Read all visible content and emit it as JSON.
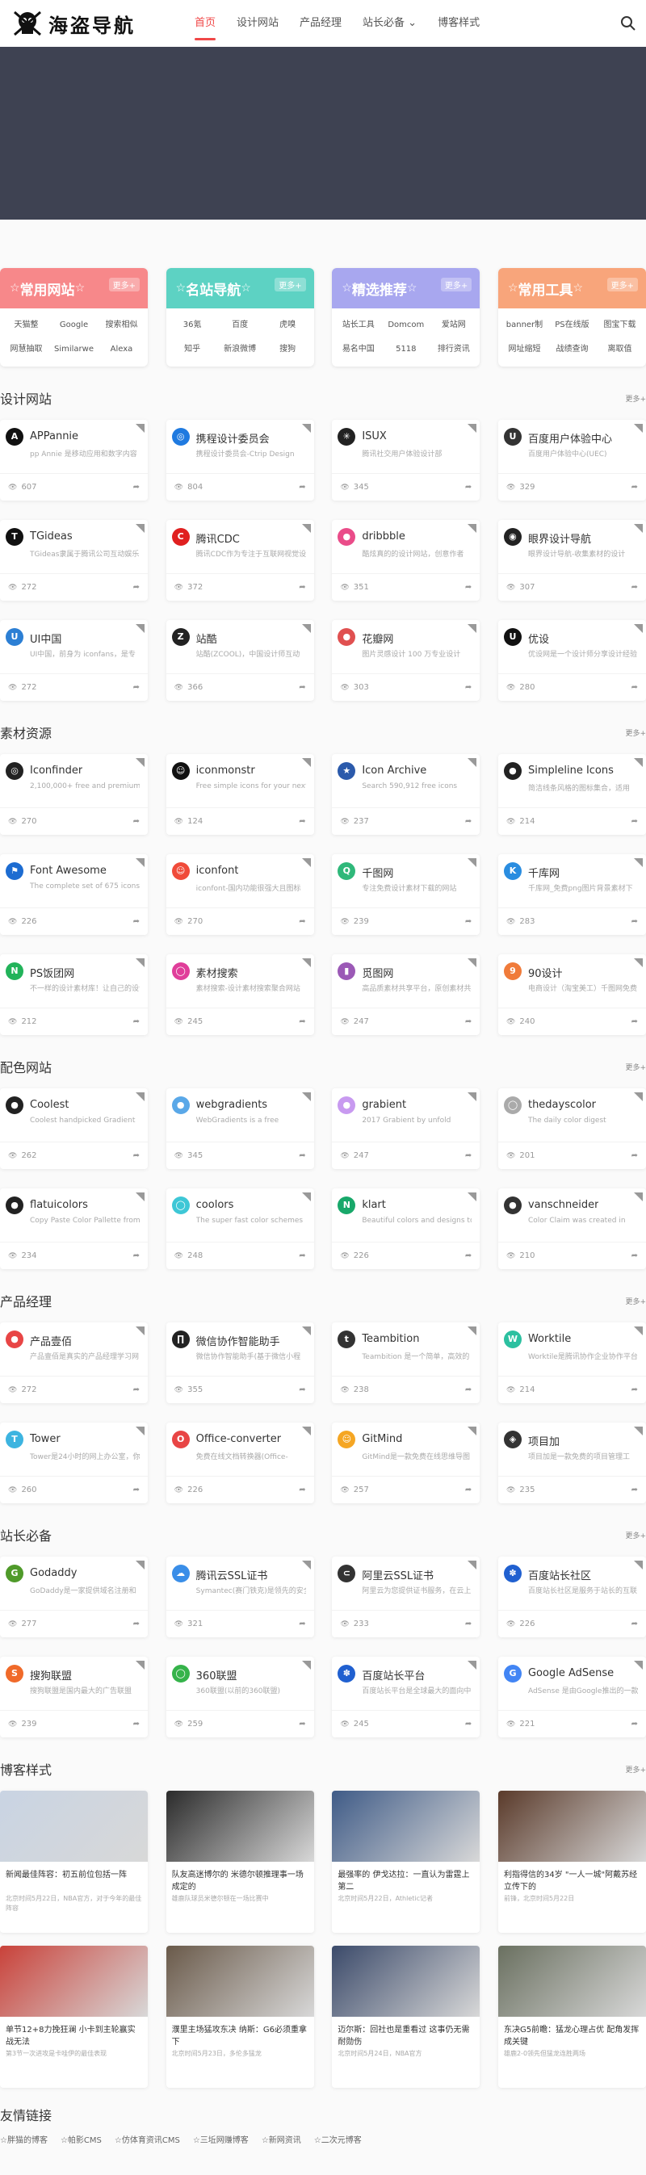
{
  "logo": {
    "text": "海盗导航"
  },
  "nav": [
    {
      "label": "首页",
      "active": true
    },
    {
      "label": "设计网站"
    },
    {
      "label": "产品经理"
    },
    {
      "label": "站长必备 ⌄"
    },
    {
      "label": "博客样式"
    }
  ],
  "colors": {
    "accent": "#f04848",
    "banner": "#3e4252",
    "cat1": "#f7888a",
    "cat2": "#5dd2c3",
    "cat3": "#a8a7ef",
    "cat4": "#f8a57b"
  },
  "categories": [
    {
      "title": "常用网站",
      "more": "更多+",
      "items": [
        "天猫整",
        "Google",
        "搜索相似",
        "网慧抽取",
        "Similarwe",
        "Alexa"
      ]
    },
    {
      "title": "名站导航",
      "more": "更多+",
      "items": [
        "36氪",
        "百度",
        "虎嗅",
        "知乎",
        "新浪微博",
        "搜狗"
      ]
    },
    {
      "title": "精选推荐",
      "more": "更多+",
      "items": [
        "站长工具",
        "Domcom",
        "爱站网",
        "易名中国",
        "5118",
        "排行资讯"
      ]
    },
    {
      "title": "常用工具",
      "more": "更多+",
      "items": [
        "banner制",
        "PS在线版",
        "图宝下载",
        "网址缩短",
        "战绩查询",
        "离取值"
      ]
    }
  ],
  "sections": [
    {
      "title": "设计网站",
      "more": "更多+",
      "cards": [
        {
          "name": "APPannie",
          "desc": "pp Annie 是移动应用和数字内容",
          "views": "607",
          "icon": "A",
          "color": "#111"
        },
        {
          "name": "携程设计委员会",
          "desc": "携程设计委员会-Ctrip Design",
          "views": "804",
          "icon": "◎",
          "color": "#1f7ae0"
        },
        {
          "name": "ISUX",
          "desc": "腾讯社交用户体验设计部",
          "views": "345",
          "icon": "✳",
          "color": "#222"
        },
        {
          "name": "百度用户体验中心",
          "desc": "百度用户体验中心(UEC)",
          "views": "329",
          "icon": "U",
          "color": "#333"
        },
        {
          "name": "TGideas",
          "desc": "TGideas隶属于腾讯公司互动娱乐",
          "views": "272",
          "icon": "T",
          "color": "#111"
        },
        {
          "name": "腾讯CDC",
          "desc": "腾讯CDC作为专注于互联网视觉设计",
          "views": "372",
          "icon": "C",
          "color": "#e02020"
        },
        {
          "name": "dribbble",
          "desc": "酷炫真的的设计网站，创意作者",
          "views": "351",
          "icon": "●",
          "color": "#ea4c89"
        },
        {
          "name": "眼界设计导航",
          "desc": "眼界设计导航-收集素材的设计",
          "views": "307",
          "icon": "◉",
          "color": "#222"
        },
        {
          "name": "UI中国",
          "desc": "UI中国，前身为 iconfans，是专",
          "views": "272",
          "icon": "U",
          "color": "#2c7fd4"
        },
        {
          "name": "站酷",
          "desc": "站酷(ZCOOL)，中国设计师互动",
          "views": "366",
          "icon": "Z",
          "color": "#222"
        },
        {
          "name": "花瓣网",
          "desc": "图片灵感设计 100 万专业设计",
          "views": "303",
          "icon": "●",
          "color": "#e05050"
        },
        {
          "name": "优设",
          "desc": "优设网是一个设计师分享设计经验",
          "views": "280",
          "icon": "U",
          "color": "#111"
        }
      ]
    },
    {
      "title": "素材资源",
      "more": "更多+",
      "cards": [
        {
          "name": "Iconfinder",
          "desc": "2,100,000+ free and premium",
          "views": "270",
          "icon": "◎",
          "color": "#222"
        },
        {
          "name": "iconmonstr",
          "desc": "Free simple icons for your next",
          "views": "124",
          "icon": "☺",
          "color": "#111"
        },
        {
          "name": "Icon Archive",
          "desc": "Search 590,912 free icons",
          "views": "237",
          "icon": "★",
          "color": "#2b5aab"
        },
        {
          "name": "Simpleline Icons",
          "desc": "简洁线条风格的图标集合，适用",
          "views": "214",
          "icon": "●",
          "color": "#222"
        },
        {
          "name": "Font Awesome",
          "desc": "The complete set of 675 icons",
          "views": "226",
          "icon": "⚑",
          "color": "#1d6cd1"
        },
        {
          "name": "iconfont",
          "desc": "iconfont-国内功能很强大且图标",
          "views": "270",
          "icon": "☺",
          "color": "#f04b3a"
        },
        {
          "name": "千图网",
          "desc": "专注免费设计素材下载的网站",
          "views": "239",
          "icon": "Q",
          "color": "#2fb87a"
        },
        {
          "name": "千库网",
          "desc": "千库网_免费png图片背景素材下",
          "views": "283",
          "icon": "K",
          "color": "#2a8de0"
        },
        {
          "name": "PS饭团网",
          "desc": "不一样的设计素材库！让自己的设计",
          "views": "212",
          "icon": "N",
          "color": "#22b35a"
        },
        {
          "name": "素材搜索",
          "desc": "素材搜索-设计素材搜索聚合网站",
          "views": "245",
          "icon": "◯",
          "color": "#e03e9a"
        },
        {
          "name": "觅图网",
          "desc": "高品质素材共享平台，原创素材共享",
          "views": "247",
          "icon": "▮",
          "color": "#9b59b6"
        },
        {
          "name": "90设计",
          "desc": "电商设计（淘宝美工）千图网免费",
          "views": "240",
          "icon": "9",
          "color": "#f07b3a"
        }
      ]
    },
    {
      "title": "配色网站",
      "more": "更多+",
      "cards": [
        {
          "name": "Coolest",
          "desc": "Coolest handpicked Gradient",
          "views": "262",
          "icon": "●",
          "color": "#222"
        },
        {
          "name": "webgradients",
          "desc": "WebGradients is a free",
          "views": "345",
          "icon": "●",
          "color": "#5aa8e8"
        },
        {
          "name": "grabient",
          "desc": "2017 Grabient by unfold",
          "views": "247",
          "icon": "●",
          "color": "#c89af0"
        },
        {
          "name": "thedayscolor",
          "desc": "The daily color digest",
          "views": "201",
          "icon": "◯",
          "color": "#aaa"
        },
        {
          "name": "flatuicolors",
          "desc": "Copy Paste Color Pallette from",
          "views": "234",
          "icon": "●",
          "color": "#222"
        },
        {
          "name": "coolors",
          "desc": "The super fast color schemes",
          "views": "248",
          "icon": "◯",
          "color": "#3ec7d6"
        },
        {
          "name": "klart",
          "desc": "Beautiful colors and designs to",
          "views": "226",
          "icon": "N",
          "color": "#18a86a"
        },
        {
          "name": "vanschneider",
          "desc": "Color Claim was created in",
          "views": "210",
          "icon": "●",
          "color": "#333"
        }
      ]
    },
    {
      "title": "产品经理",
      "more": "更多+",
      "cards": [
        {
          "name": "产品壹佰",
          "desc": "产品壹佰是真实的产品经理学习网",
          "views": "272",
          "icon": "●",
          "color": "#e84545"
        },
        {
          "name": "微信协作智能助手",
          "desc": "微信协作智能助手(基于微信小程",
          "views": "355",
          "icon": "∏",
          "color": "#222"
        },
        {
          "name": "Teambition",
          "desc": "Teambition 是一个简单，高效的",
          "views": "238",
          "icon": "t",
          "color": "#333"
        },
        {
          "name": "Worktile",
          "desc": "Worktile是腾讯协作企业协作平台",
          "views": "214",
          "icon": "W",
          "color": "#2cc0a0"
        },
        {
          "name": "Tower",
          "desc": "Tower是24小时的网上办公室，你",
          "views": "260",
          "icon": "T",
          "color": "#3db4e0"
        },
        {
          "name": "Office-converter",
          "desc": "免费在线文档转换器(Office-",
          "views": "226",
          "icon": "O",
          "color": "#e84545"
        },
        {
          "name": "GitMind",
          "desc": "GitMind是一款免费在线思维导图",
          "views": "257",
          "icon": "☺",
          "color": "#f5a623"
        },
        {
          "name": "项目加",
          "desc": "项目加是一款免费的项目管理工",
          "views": "235",
          "icon": "◈",
          "color": "#333"
        }
      ]
    },
    {
      "title": "站长必备",
      "more": "更多+",
      "cards": [
        {
          "name": "Godaddy",
          "desc": "GoDaddy是一家提供域名注册和",
          "views": "277",
          "icon": "G",
          "color": "#4f9a2a"
        },
        {
          "name": "腾讯云SSL证书",
          "desc": "Symantec(赛门铁克)是领先的安全",
          "views": "321",
          "icon": "☁",
          "color": "#3a8ee8"
        },
        {
          "name": "阿里云SSL证书",
          "desc": "阿里云为您提供证书服务，在云上",
          "views": "233",
          "icon": "⊂",
          "color": "#333"
        },
        {
          "name": "百度站长社区",
          "desc": "百度站长社区是服务于站长的互联",
          "views": "226",
          "icon": "✽",
          "color": "#2060d0"
        },
        {
          "name": "搜狗联盟",
          "desc": "搜狗联盟是国内最大的广告联盟",
          "views": "239",
          "icon": "S",
          "color": "#f06a2a"
        },
        {
          "name": "360联盟",
          "desc": "360联盟(以前的360联盟)",
          "views": "259",
          "icon": "◯",
          "color": "#35b34a"
        },
        {
          "name": "百度站长平台",
          "desc": "百度站长平台是全球最大的面向中",
          "views": "245",
          "icon": "✽",
          "color": "#2060d0"
        },
        {
          "name": "Google AdSense",
          "desc": "AdSense 是由Google推出的一款",
          "views": "221",
          "icon": "G",
          "color": "#4285f4"
        }
      ]
    }
  ],
  "blog": {
    "title": "博客样式",
    "more": "更多+",
    "posts": [
      {
        "title": "新闻最佳阵容：初五前位包括一阵",
        "desc": "北京时间5月22日，NBA官方，对于今年的最佳阵容",
        "img": "#c9d4e3"
      },
      {
        "title": "队友高迷博尔的 米德尔顿推理事一场成定的",
        "desc": "雄鹿队球员米德尔顿在一场比赛中",
        "img": "#2b2b2b"
      },
      {
        "title": "最强率的 伊戈达拉：一直认为雷霆上第二",
        "desc": "北京时间5月22日，Athletic记者",
        "img": "#3f5b87"
      },
      {
        "title": "利指得信的34岁 \"一人一城\"阿戴苏经立传下的",
        "desc": "前锋，北京时间5月22日",
        "img": "#5a3a2a"
      },
      {
        "title": "单节12+8力挽狂澜 小卡到主轮赢实战无法",
        "desc": "第3节一次进攻是卡哇伊的最佳表现",
        "img": "#c9423a"
      },
      {
        "title": "濮里主场猛攻东决 纳斯：G6必须重拿下",
        "desc": "北京时间5月23日，多伦多猛龙",
        "img": "#6a5a4a"
      },
      {
        "title": "迈尔斯：回社也是重看过 这事仍无需耐勋伤",
        "desc": "北京时间5月24日，NBA官方",
        "img": "#3b4a6a"
      },
      {
        "title": "东决G5前瞻：猛龙心理占优 配角发挥成关键",
        "desc": "雄鹿2-0领先但猛龙连胜两场",
        "img": "#6a7060"
      }
    ]
  },
  "friends": {
    "title": "友情链接",
    "items": [
      "☆胖猫的博客",
      "☆帕影CMS",
      "☆仿体育资讯CMS",
      "☆三坵网赚博客",
      "☆新网资讯",
      "☆二次元博客"
    ]
  }
}
